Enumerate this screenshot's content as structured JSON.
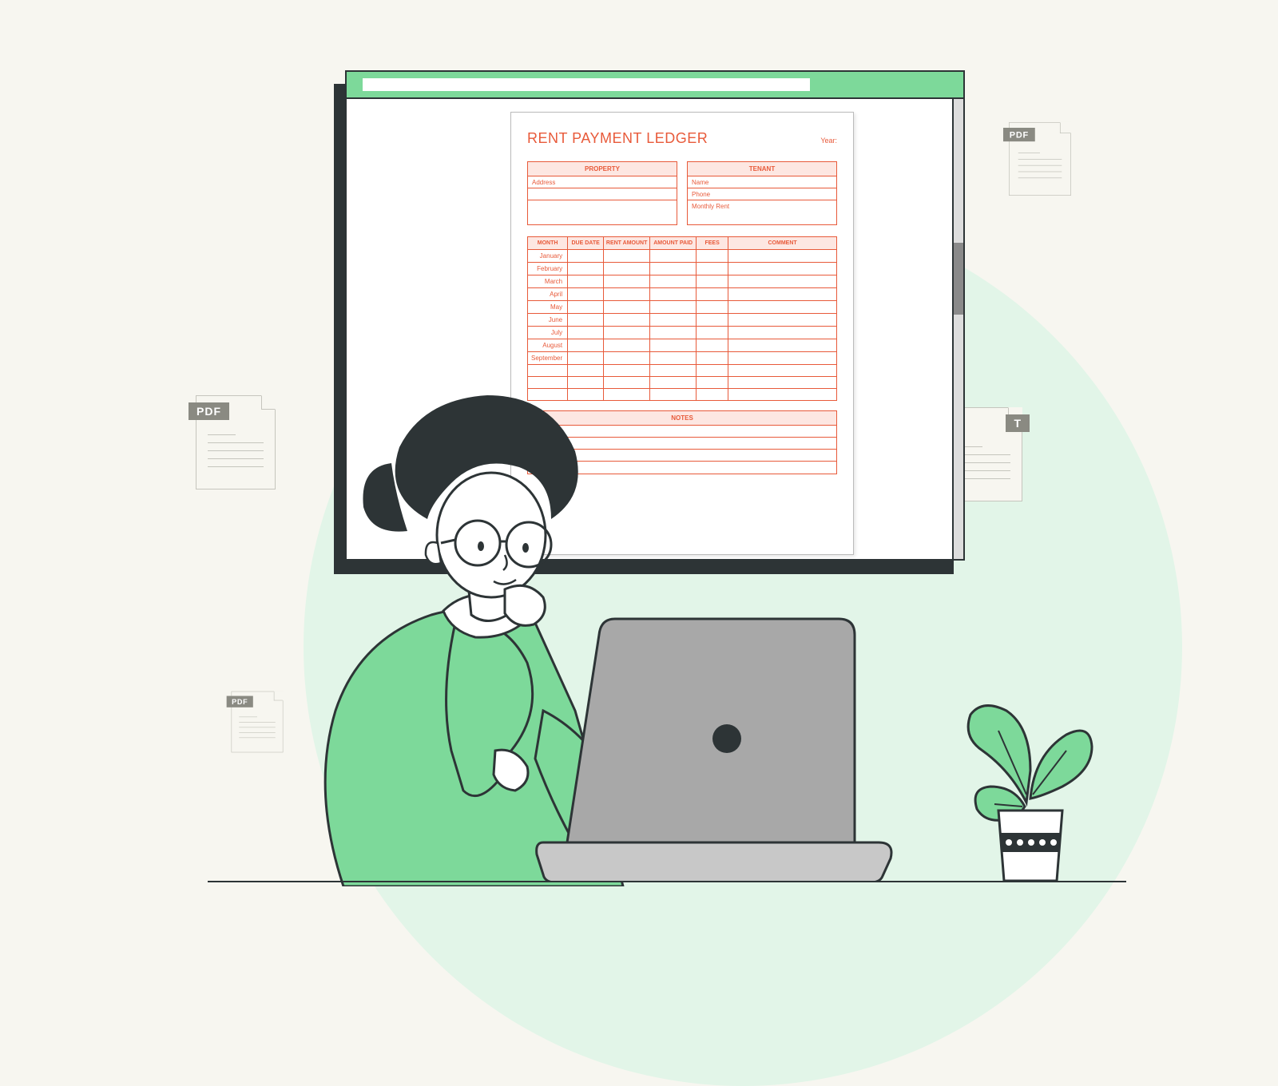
{
  "document": {
    "title": "RENT PAYMENT LEDGER",
    "year_label": "Year:",
    "property_header": "PROPERTY",
    "tenant_header": "TENANT",
    "property_fields": [
      "Address"
    ],
    "tenant_fields": [
      "Name",
      "Phone",
      "Monthly Rent"
    ],
    "columns": [
      "MONTH",
      "DUE DATE",
      "RENT AMOUNT",
      "AMOUNT PAID",
      "FEES",
      "COMMENT"
    ],
    "months": [
      "January",
      "February",
      "March",
      "April",
      "May",
      "June",
      "July",
      "August",
      "September"
    ],
    "extra_blank_rows": 3,
    "notes_header": "NOTES",
    "notes_lines": 4
  },
  "pdf_label": "PDF"
}
